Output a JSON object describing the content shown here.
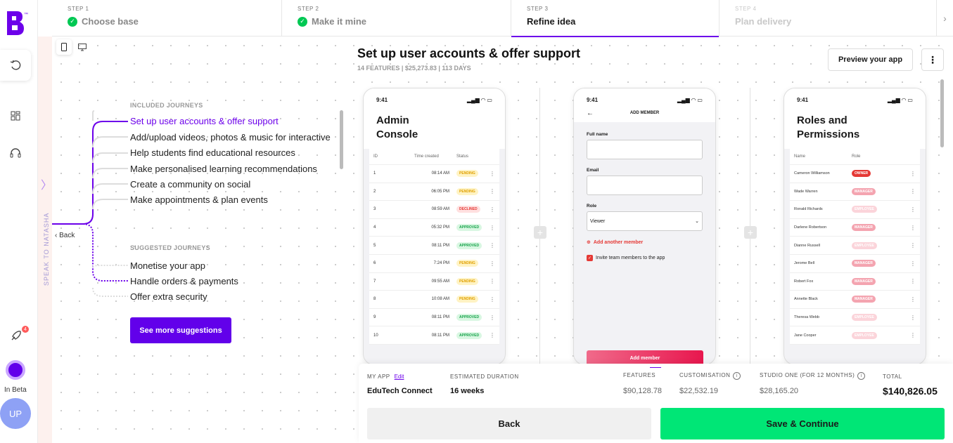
{
  "app": {
    "logo_tm": "™",
    "beta_label": "In Beta",
    "avatar_initials": "UP",
    "notification_count": "4",
    "speak_to": "SPEAK TO NATASHA",
    "brand_color": "#6c00ea"
  },
  "stepper": {
    "steps": [
      {
        "label": "STEP 1",
        "name": "Choose base"
      },
      {
        "label": "STEP 2",
        "name": "Make it mine"
      },
      {
        "label": "STEP 3",
        "name": "Refine idea"
      },
      {
        "label": "STEP 4",
        "name": "Plan delivery"
      }
    ]
  },
  "header": {
    "title": "Set up user accounts & offer support",
    "meta": "14 FEATURES | $25,273.83 | 113 DAYS",
    "preview_label": "Preview your app",
    "more_icon": "⋮"
  },
  "journeys": {
    "included_heading": "INCLUDED JOURNEYS",
    "included": [
      "Set up user accounts & offer support",
      "Add/upload videos, photos & music for interactive",
      "Help students find educational resources",
      "Make personalised learning recommendations",
      "Create a community on social",
      "Make appointments & plan events"
    ],
    "suggested_heading": "SUGGESTED JOURNEYS",
    "suggested": [
      "Monetise your app",
      "Handle orders & payments",
      "Offer extra security"
    ],
    "see_more_label": "See more suggestions",
    "back_label": "Back"
  },
  "phones": {
    "time": "9:41",
    "admin": {
      "title_line1": "Admin",
      "title_line2": "Console",
      "headers": [
        "ID",
        "Time created",
        "Status"
      ],
      "rows": [
        {
          "id": "1",
          "time": "08:14 AM",
          "status": "PENDING",
          "cls": "p-pending"
        },
        {
          "id": "2",
          "time": "06:05 PM",
          "status": "PENDING",
          "cls": "p-pending"
        },
        {
          "id": "3",
          "time": "08:59 AM",
          "status": "DECLINED",
          "cls": "p-declined"
        },
        {
          "id": "4",
          "time": "05:32 PM",
          "status": "APPROVED",
          "cls": "p-approved"
        },
        {
          "id": "5",
          "time": "08:11 PM",
          "status": "APPROVED",
          "cls": "p-approved"
        },
        {
          "id": "6",
          "time": "7:24 PM",
          "status": "PENDING",
          "cls": "p-pending"
        },
        {
          "id": "7",
          "time": "09:55 AM",
          "status": "PENDING",
          "cls": "p-pending"
        },
        {
          "id": "8",
          "time": "10:08 AM",
          "status": "PENDING",
          "cls": "p-pending"
        },
        {
          "id": "9",
          "time": "08:11 PM",
          "status": "APPROVED",
          "cls": "p-approved"
        },
        {
          "id": "10",
          "time": "08:11 PM",
          "status": "APPROVED",
          "cls": "p-approved"
        }
      ]
    },
    "member": {
      "title": "ADD MEMBER",
      "full_name_label": "Full name",
      "email_label": "Email",
      "role_label": "Role",
      "role_value": "Viewer",
      "add_another": "Add another member",
      "invite_label": "Invite team members to the app",
      "add_button": "Add member"
    },
    "roles": {
      "title_line1": "Roles and",
      "title_line2": "Permissions",
      "headers": [
        "Name",
        "Role"
      ],
      "rows": [
        {
          "name": "Cameron Williamson",
          "role": "OWNER",
          "cls": "p-owner"
        },
        {
          "name": "Wade Warren",
          "role": "MANAGER",
          "cls": "p-manager"
        },
        {
          "name": "Ronald Richards",
          "role": "EMPLOYEE",
          "cls": "p-employee"
        },
        {
          "name": "Darlene Robertson",
          "role": "MANAGER",
          "cls": "p-manager"
        },
        {
          "name": "Dianne Russell",
          "role": "EMPLOYEE",
          "cls": "p-employee"
        },
        {
          "name": "Jerome Bell",
          "role": "MANAGER",
          "cls": "p-manager"
        },
        {
          "name": "Robert Fox",
          "role": "MANAGER",
          "cls": "p-manager"
        },
        {
          "name": "Annette Black",
          "role": "MANAGER",
          "cls": "p-manager"
        },
        {
          "name": "Theresa Webb",
          "role": "EMPLOYEE",
          "cls": "p-employee"
        },
        {
          "name": "Jane Cooper",
          "role": "EMPLOYEE",
          "cls": "p-employee"
        }
      ]
    }
  },
  "summary": {
    "my_app_label": "MY APP",
    "edit_label": "Edit",
    "app_name": "EduTech Connect",
    "duration_label": "ESTIMATED DURATION",
    "duration_value": "16 weeks",
    "features_label": "FEATURES",
    "features_value": "$90,128.78",
    "custom_label": "CUSTOMISATION",
    "custom_value": "$22,532.19",
    "studio_label": "STUDIO ONE (FOR 12 MONTHS)",
    "studio_value": "$28,165.20",
    "total_label": "TOTAL",
    "total_value": "$140,826.05",
    "back_button": "Back",
    "save_button": "Save & Continue"
  }
}
